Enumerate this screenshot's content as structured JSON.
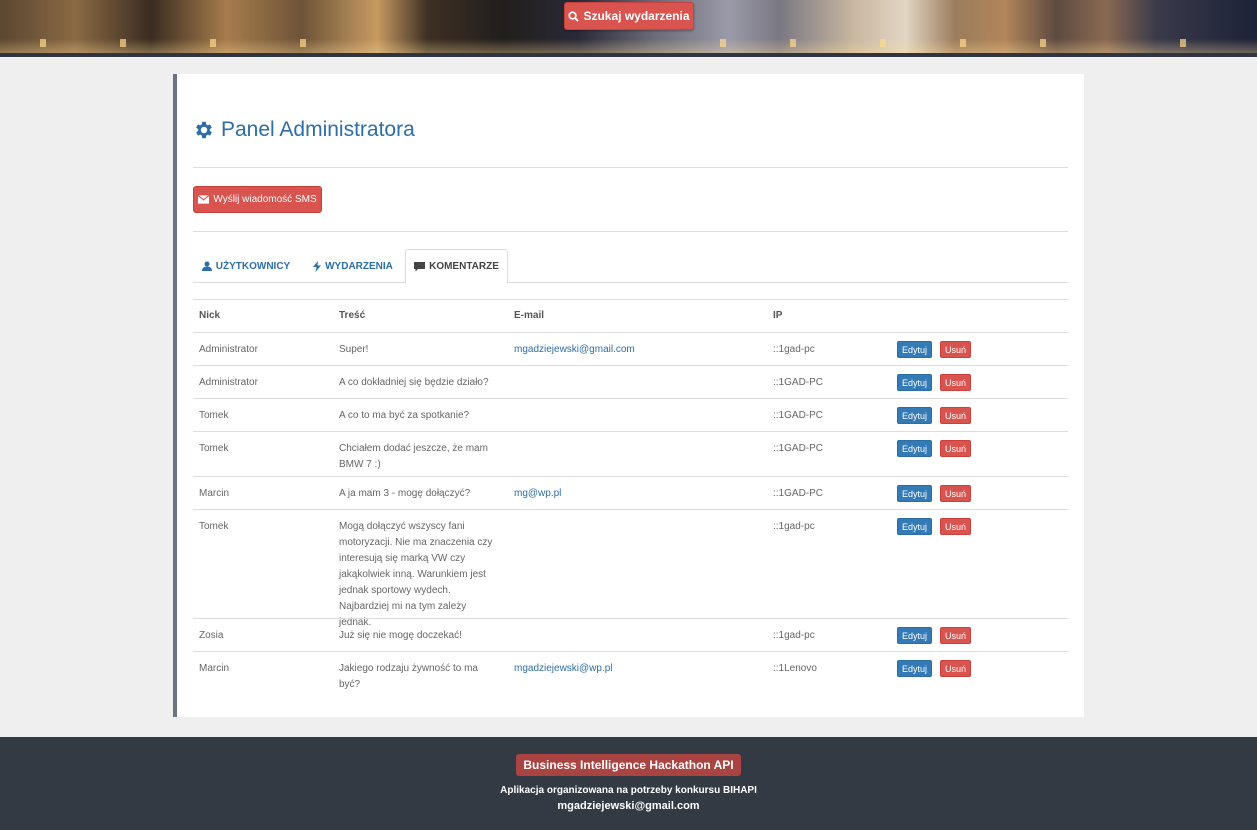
{
  "header": {
    "search_button_label": "Szukaj wydarzenia"
  },
  "panel": {
    "title": "Panel Administratora",
    "sms_button_label": "Wyślij wiadomość SMS",
    "tabs": [
      {
        "label": "UŻYTKOWNICY",
        "icon": "user-icon",
        "active": false
      },
      {
        "label": "WYDARZENIA",
        "icon": "bolt-icon",
        "active": false
      },
      {
        "label": "KOMENTARZE",
        "icon": "comment-icon",
        "active": true
      }
    ],
    "columns": [
      "Nick",
      "Treść",
      "E-mail",
      "IP"
    ],
    "edit_label": "Edytuj",
    "delete_label": "Usuń",
    "rows": [
      {
        "nick": "Administrator",
        "text": "Super!",
        "email": "mgadziejewski@gmail.com",
        "ip": "::1gad-pc"
      },
      {
        "nick": "Administrator",
        "text": "A co dokładniej się będzie działo?",
        "email": "",
        "ip": "::1GAD-PC"
      },
      {
        "nick": "Tomek",
        "text": "A co to ma być za spotkanie?",
        "email": "",
        "ip": "::1GAD-PC"
      },
      {
        "nick": "Tomek",
        "text": "Chciałem dodać jeszcze, że mam BMW 7 :)",
        "email": "",
        "ip": "::1GAD-PC"
      },
      {
        "nick": "Marcin",
        "text": "A ja mam 3 - mogę dołączyć?",
        "email": "mg@wp.pl",
        "ip": "::1GAD-PC"
      },
      {
        "nick": "Tomek",
        "text": "Mogą dołączyć wszyscy fani motoryzacji. Nie ma znaczenia czy interesują się marką VW czy jakąkolwiek inną. Warunkiem jest jednak sportowy wydech. Najbardziej mi na tym zależy jednak.",
        "email": "",
        "ip": "::1gad-pc"
      },
      {
        "nick": "Zosia",
        "text": "Już się nie mogę doczekać!",
        "email": "",
        "ip": "::1gad-pc"
      },
      {
        "nick": "Marcin",
        "text": "Jakiego rodzaju żywność to ma być?",
        "email": "mgadziejewski@wp.pl",
        "ip": "::1Lenovo"
      }
    ]
  },
  "footer": {
    "badge": "Business Intelligence Hackathon API",
    "description": "Aplikacja organizowana na potrzeby konkursu BIHAPI",
    "email": "mgadziejewski@gmail.com"
  }
}
